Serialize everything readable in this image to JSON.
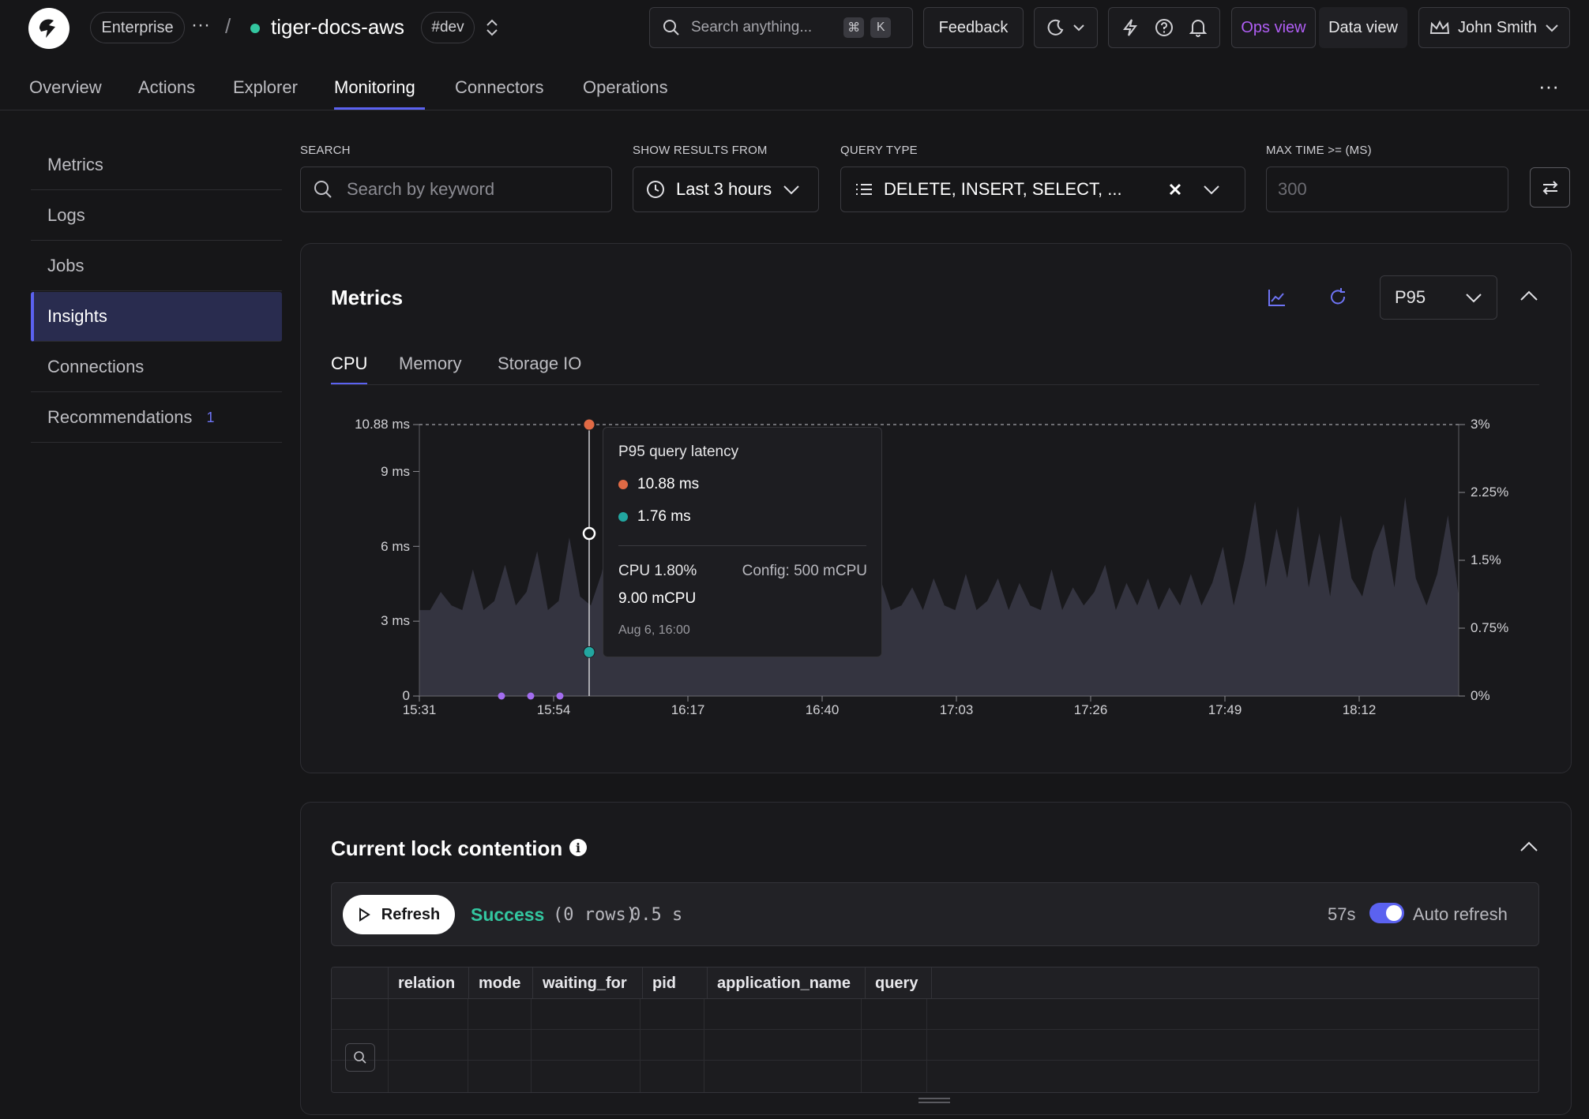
{
  "topbar": {
    "plan": "Enterprise",
    "more": "···",
    "separator": "/",
    "service_name": "tiger-docs-aws",
    "env": "#dev",
    "search_placeholder": "Search anything...",
    "search_key1": "⌘",
    "search_key2": "K",
    "feedback": "Feedback",
    "ops_view": "Ops view",
    "data_view": "Data view",
    "user_name": "John Smith"
  },
  "nav": {
    "tabs": [
      "Overview",
      "Actions",
      "Explorer",
      "Monitoring",
      "Connectors",
      "Operations"
    ],
    "active": "Monitoring",
    "more": "···"
  },
  "sidebar": {
    "items": [
      {
        "label": "Metrics"
      },
      {
        "label": "Logs"
      },
      {
        "label": "Jobs"
      },
      {
        "label": "Insights"
      },
      {
        "label": "Connections"
      },
      {
        "label": "Recommendations",
        "badge": "1"
      }
    ],
    "active": "Insights"
  },
  "filters": {
    "search_label": "SEARCH",
    "search_placeholder": "Search by keyword",
    "results_label": "SHOW RESULTS FROM",
    "results_value": "Last 3 hours",
    "query_type_label": "QUERY TYPE",
    "query_type_value": "DELETE, INSERT, SELECT, ...",
    "max_time_label": "MAX TIME >= (MS)",
    "max_time_placeholder": "300"
  },
  "metrics_panel": {
    "title": "Metrics",
    "percentile": "P95",
    "tabs": [
      "CPU",
      "Memory",
      "Storage IO"
    ],
    "active_tab": "CPU"
  },
  "chart_data": {
    "type": "area",
    "title": "",
    "y_left_ticks": [
      "0",
      "3 ms",
      "6 ms",
      "9 ms",
      "10.88 ms"
    ],
    "y_left_values": [
      0,
      3,
      6,
      9,
      10.88
    ],
    "y_right_ticks": [
      "0%",
      "0.75%",
      "1.5%",
      "2.25%",
      "3%"
    ],
    "y_right_values": [
      0,
      0.75,
      1.5,
      2.25,
      3
    ],
    "x_ticks": [
      "15:31",
      "15:54",
      "16:17",
      "16:40",
      "17:03",
      "17:26",
      "17:49",
      "18:12"
    ],
    "grid": false,
    "series": [
      {
        "name": "p95-cpu-usage",
        "color": "#3a3a46",
        "values": [
          0.95,
          0.95,
          1.15,
          1.0,
          0.95,
          1.4,
          0.95,
          1.05,
          1.45,
          1.0,
          1.15,
          1.6,
          0.95,
          1.05,
          1.75,
          1.1,
          1.0,
          1.35,
          1.9,
          2.6,
          1.0,
          1.5,
          2.4,
          1.0,
          1.25,
          1.9,
          1.45,
          1.1,
          1.35,
          1.0,
          1.5,
          1.1,
          1.0,
          1.3,
          1.0,
          0.95,
          1.2,
          0.95,
          1.3,
          1.0,
          0.95,
          1.25,
          0.95,
          1.3,
          0.95,
          1.0,
          1.2,
          0.95,
          1.3,
          1.0,
          0.95,
          1.35,
          0.95,
          1.05,
          1.3,
          0.95,
          1.25,
          1.0,
          0.95,
          1.4,
          0.95,
          1.2,
          1.0,
          1.15,
          1.45,
          0.95,
          1.25,
          1.0,
          1.3,
          0.95,
          1.2,
          1.0,
          1.35,
          1.0,
          1.25,
          1.65,
          1.0,
          1.5,
          2.15,
          1.2,
          1.85,
          1.3,
          2.1,
          1.2,
          1.8,
          1.1,
          2.0,
          1.3,
          1.1,
          1.6,
          1.9,
          1.2,
          2.2,
          1.3,
          1.0,
          1.35,
          2.0,
          1.1
        ]
      }
    ],
    "markers": [
      {
        "series": "p95-query-latency",
        "color": "#e06a45",
        "x": "Aug 6, 16:00",
        "value": 10.88
      },
      {
        "series": "p95-query-latency",
        "color": "#22a6a0",
        "x": "Aug 6, 16:00",
        "value": 1.76
      }
    ],
    "tooltip": {
      "title": "P95 query latency",
      "rows": [
        {
          "color": "#e06a45",
          "value": "10.88 ms"
        },
        {
          "color": "#22a6a0",
          "value": "1.76 ms"
        }
      ],
      "cpu": "CPU 1.80%",
      "config": "Config: 500 mCPU",
      "mcpu": "9.00 mCPU",
      "time": "Aug 6, 16:00"
    }
  },
  "lock_panel": {
    "title": "Current lock contention",
    "refresh": "Refresh",
    "status": "Success",
    "rows_info": "(0 rows)",
    "duration": "0.5 s",
    "countdown": "57s",
    "auto_refresh": "Auto refresh",
    "columns": [
      "relation",
      "mode",
      "waiting_for",
      "pid",
      "application_name",
      "query"
    ]
  },
  "colors": {
    "accent": "#5b62f0",
    "success": "#33c7a0",
    "ops_view": "#b05ef5"
  }
}
